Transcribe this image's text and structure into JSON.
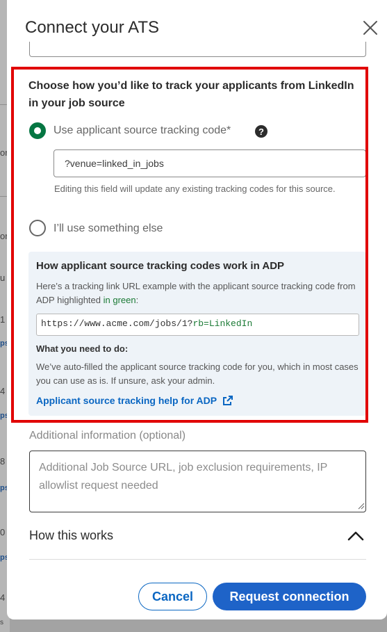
{
  "modal": {
    "title": "Connect your ATS",
    "close_label": "×"
  },
  "tracking": {
    "heading": "Choose how you’d like to track your applicants from LinkedIn in your job source",
    "option_code_label": "Use applicant source tracking code*",
    "option_code_selected": true,
    "help_glyph": "?",
    "code_value": "?venue=linked_in_jobs",
    "hint": "Editing this field will update any existing tracking codes for this source.",
    "option_else_label": "I’ll use something else",
    "option_else_selected": false
  },
  "info": {
    "title": "How applicant source tracking codes work in ADP",
    "body_prefix": "Here’s a tracking link URL example with the applicant source tracking code from ADP highlighted ",
    "body_green": "in green",
    "body_suffix": ":",
    "url_base": "https://www.acme.com/jobs/1?",
    "url_code": "rb=LinkedIn",
    "need_title": "What you need to do:",
    "need_body": "We’ve auto-filled the applicant source tracking code for you, which in most cases you can use as is. If unsure, ask your admin.",
    "help_link": "Applicant source tracking help for ADP"
  },
  "additional": {
    "label": "Additional information (optional)",
    "placeholder": "Additional Job Source URL, job exclusion requirements, IP allowlist request needed"
  },
  "how_it_works": {
    "label": "How this works",
    "expanded": true
  },
  "actions": {
    "cancel": "Cancel",
    "request": "Request connection"
  },
  "background": {
    "fragments": [
      "or",
      "or",
      "u",
      "1",
      "ps",
      "4",
      "ps",
      "8",
      "ps",
      "0",
      "ps",
      "4",
      "s"
    ]
  },
  "colors": {
    "accent_blue": "#0a66c2",
    "primary_button": "#1e63c8",
    "radio_green": "#057642",
    "highlight_red": "#e10000",
    "info_bg": "#eef3f8"
  }
}
